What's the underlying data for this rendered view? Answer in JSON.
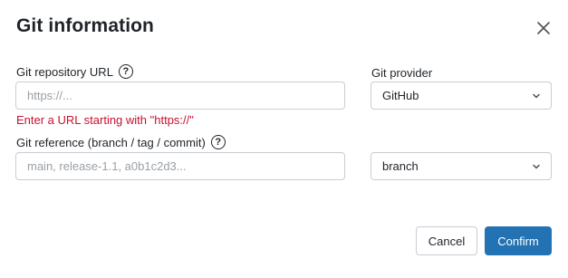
{
  "dialog": {
    "title": "Git information"
  },
  "repo_url": {
    "label": "Git repository URL",
    "placeholder": "https://...",
    "value": "",
    "error": "Enter a URL starting with \"https://\""
  },
  "provider": {
    "label": "Git provider",
    "selected": "GitHub"
  },
  "reference": {
    "label": "Git reference (branch / tag / commit)",
    "placeholder": "main, release-1.1, a0b1c2d3...",
    "value": "",
    "type_selected": "branch"
  },
  "footer": {
    "cancel_label": "Cancel",
    "confirm_label": "Confirm"
  },
  "colors": {
    "primary": "#2272b4",
    "error": "#c8102e",
    "border": "#c9cdd2"
  },
  "icons": {
    "close": "close-icon",
    "help": "help-icon",
    "dropdown": "chevron-down-icon"
  }
}
